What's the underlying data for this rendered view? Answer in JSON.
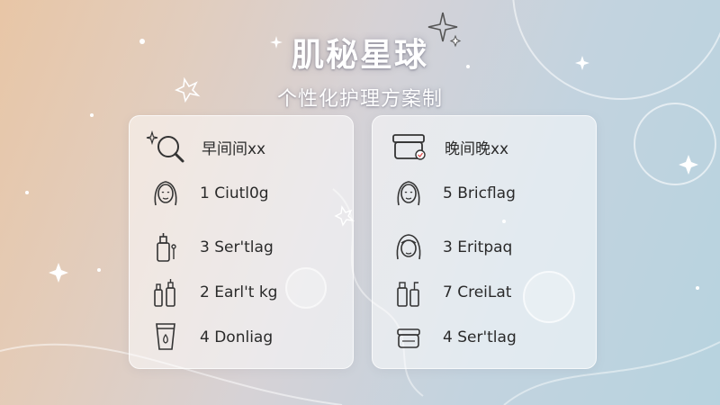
{
  "header": {
    "title": "肌秘星球",
    "subtitle": "个性化护理方案制"
  },
  "morning": {
    "title": "早间间xx",
    "icon": "magnifier-sparkle-icon",
    "items": [
      {
        "label": "1 Ciutl0g",
        "icon": "face-icon"
      },
      {
        "label": "3 Ser'tlag",
        "icon": "serum-bottle-icon"
      },
      {
        "label": "2 Earl't kg",
        "icon": "bottles-icon"
      },
      {
        "label": "4 Donliag",
        "icon": "tube-icon"
      }
    ]
  },
  "evening": {
    "title": "晚间晚xx",
    "icon": "cream-jar-icon",
    "items": [
      {
        "label": "5 Bricflag",
        "icon": "face-icon"
      },
      {
        "label": "3 Eritpaq",
        "icon": "face-icon"
      },
      {
        "label": "7 CreiLat",
        "icon": "bottle-pump-icon"
      },
      {
        "label": "4 Ser'tlag",
        "icon": "jar-icon"
      }
    ]
  },
  "colors": {
    "text": "#2a2a2a",
    "icon_stroke": "#333333",
    "card_bg": "rgba(255,255,255,0.52)"
  }
}
